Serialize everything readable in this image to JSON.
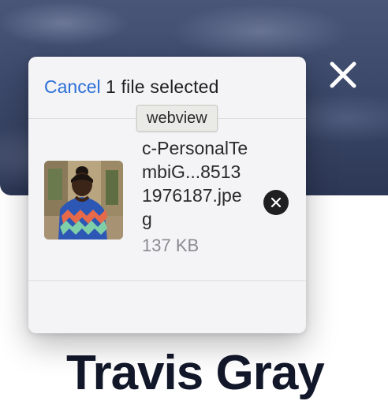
{
  "background": {
    "close_icon": "close-icon"
  },
  "profile": {
    "name": "Travis Gray"
  },
  "file_picker": {
    "cancel_label": "Cancel",
    "title": "1 file selected",
    "tooltip": "webview",
    "file": {
      "name": "c-PersonalTembiG...85131976187.jpeg",
      "size": "137 KB",
      "thumbnail_icon": "photo-thumbnail",
      "remove_icon": "remove-circle-icon"
    }
  },
  "colors": {
    "accent": "#2c6fd6",
    "heading": "#12172a",
    "sheet_bg": "#f4f4f6"
  }
}
